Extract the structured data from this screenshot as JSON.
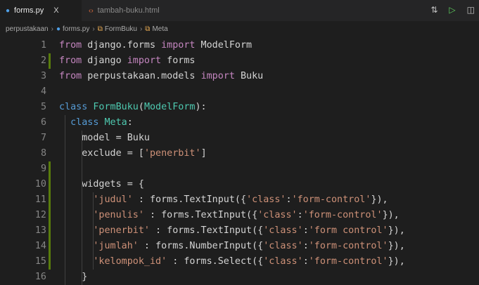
{
  "tabs": [
    {
      "label": "forms.py",
      "close": "X",
      "icon": "python-icon",
      "active": true
    },
    {
      "label": "tambah-buku.html",
      "icon": "html-icon",
      "active": false
    }
  ],
  "breadcrumb": {
    "folder": "perpustakaan",
    "file": "forms.py",
    "class": "FormBuku",
    "inner": "Meta"
  },
  "editor": {
    "lines": [
      {
        "n": "1",
        "tokens": [
          [
            "kw",
            "from"
          ],
          [
            "t",
            " django.forms "
          ],
          [
            "kw",
            "import"
          ],
          [
            "t",
            " ModelForm"
          ]
        ]
      },
      {
        "n": "2",
        "tokens": [
          [
            "kw",
            "from"
          ],
          [
            "t",
            " django "
          ],
          [
            "kw",
            "import"
          ],
          [
            "t",
            " forms"
          ]
        ]
      },
      {
        "n": "3",
        "tokens": [
          [
            "kw",
            "from"
          ],
          [
            "t",
            " perpustakaan.models "
          ],
          [
            "kw",
            "import"
          ],
          [
            "t",
            " Buku"
          ]
        ]
      },
      {
        "n": "4",
        "tokens": []
      },
      {
        "n": "5",
        "tokens": [
          [
            "def",
            "class"
          ],
          [
            "t",
            " "
          ],
          [
            "cls",
            "FormBuku"
          ],
          [
            "t",
            "("
          ],
          [
            "cls",
            "ModelForm"
          ],
          [
            "t",
            "):"
          ]
        ]
      },
      {
        "n": "6",
        "tokens": [
          [
            "t",
            "  "
          ],
          [
            "def",
            "class"
          ],
          [
            "t",
            " "
          ],
          [
            "cls",
            "Meta"
          ],
          [
            "t",
            ":"
          ]
        ]
      },
      {
        "n": "7",
        "tokens": [
          [
            "t",
            "    model = Buku"
          ]
        ]
      },
      {
        "n": "8",
        "tokens": [
          [
            "t",
            "    exclude = ["
          ],
          [
            "str",
            "'penerbit'"
          ],
          [
            "t",
            "]"
          ]
        ]
      },
      {
        "n": "9",
        "tokens": []
      },
      {
        "n": "10",
        "tokens": [
          [
            "t",
            "    widgets = {"
          ]
        ]
      },
      {
        "n": "11",
        "tokens": [
          [
            "t",
            "      "
          ],
          [
            "str",
            "'judul'"
          ],
          [
            "t",
            " : forms.TextInput({"
          ],
          [
            "str",
            "'class'"
          ],
          [
            "t",
            ":"
          ],
          [
            "str",
            "'form-control'"
          ],
          [
            "t",
            "}),"
          ]
        ]
      },
      {
        "n": "12",
        "tokens": [
          [
            "t",
            "      "
          ],
          [
            "str",
            "'penulis'"
          ],
          [
            "t",
            " : forms.TextInput({"
          ],
          [
            "str",
            "'class'"
          ],
          [
            "t",
            ":"
          ],
          [
            "str",
            "'form-control'"
          ],
          [
            "t",
            "}),"
          ]
        ]
      },
      {
        "n": "13",
        "tokens": [
          [
            "t",
            "      "
          ],
          [
            "str",
            "'penerbit'"
          ],
          [
            "t",
            " : forms.TextInput({"
          ],
          [
            "str",
            "'class'"
          ],
          [
            "t",
            ":"
          ],
          [
            "str",
            "'form control'"
          ],
          [
            "t",
            "}),"
          ]
        ]
      },
      {
        "n": "14",
        "tokens": [
          [
            "t",
            "      "
          ],
          [
            "str",
            "'jumlah'"
          ],
          [
            "t",
            " : forms.NumberInput({"
          ],
          [
            "str",
            "'class'"
          ],
          [
            "t",
            ":"
          ],
          [
            "str",
            "'form-control'"
          ],
          [
            "t",
            "}),"
          ]
        ]
      },
      {
        "n": "15",
        "tokens": [
          [
            "t",
            "      "
          ],
          [
            "str",
            "'kelompok_id'"
          ],
          [
            "t",
            " : forms.Select({"
          ],
          [
            "str",
            "'class'"
          ],
          [
            "t",
            ":"
          ],
          [
            "str",
            "'form-control'"
          ],
          [
            "t",
            "}),"
          ]
        ]
      },
      {
        "n": "16",
        "tokens": [
          [
            "t",
            "    }"
          ]
        ]
      }
    ],
    "modified_lines": [
      "2",
      "9",
      "10",
      "11",
      "12",
      "13",
      "14",
      "15"
    ]
  },
  "actions": [
    {
      "name": "source-control-icon",
      "glyph": "⇅"
    },
    {
      "name": "run-icon",
      "glyph": "▷"
    },
    {
      "name": "split-editor-icon",
      "glyph": "◫"
    }
  ]
}
